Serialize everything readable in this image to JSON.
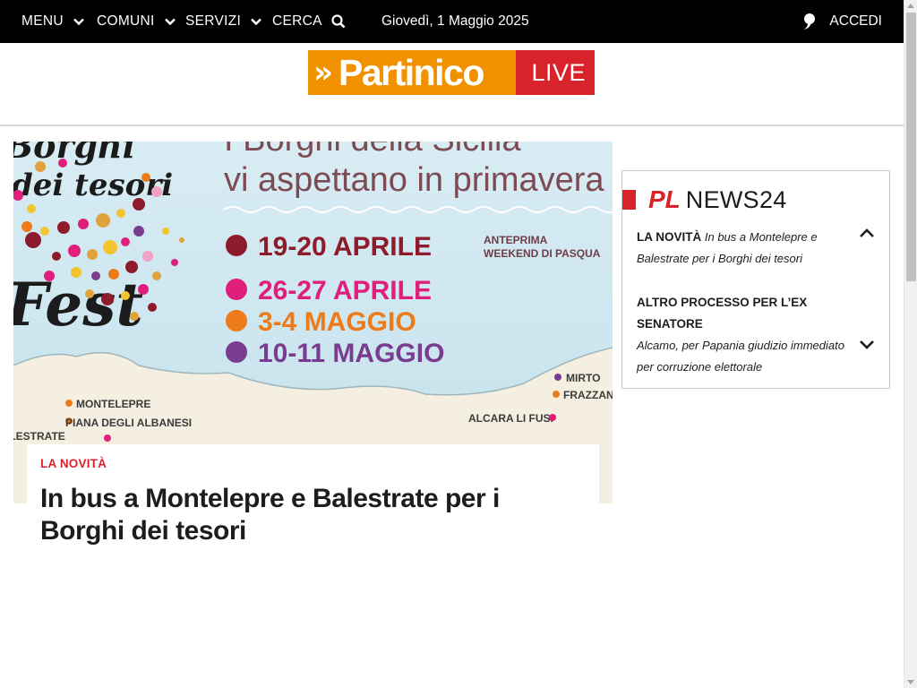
{
  "topbar": {
    "menu_label": "MENU",
    "comuni_label": "COMUNI",
    "servizi_label": "SERVIZI",
    "cerca_label": "CERCA",
    "date": "Giovedì, 1 Maggio 2025",
    "login_label": "ACCEDI"
  },
  "logo": {
    "arrows": "»",
    "name": "Partinico",
    "live": "LIVE",
    "orange": "#f29100",
    "red": "#d8232a"
  },
  "hero": {
    "image": {
      "line1": "I Borghi della Sicilia",
      "line2": "vi aspettano in primavera",
      "logo_line1": "Borghi",
      "logo_line2": "dei tesori",
      "logo_line3": "Fest",
      "dates": [
        {
          "label": "19-20 APRILE",
          "note1": "ANTEPRIMA",
          "note2": "WEEKEND DI PASQUA",
          "color": "#8d1b2b"
        },
        {
          "label": "26-27 APRILE",
          "color": "#e01f7c"
        },
        {
          "label": "3-4 MAGGIO",
          "color": "#ee7b1a"
        },
        {
          "label": "10-11 MAGGIO",
          "color": "#7a3c91"
        }
      ],
      "places": {
        "montelepre": "MONTELEPRE",
        "piana": "PIANA DEGLI ALBANESI",
        "balestrate": "BALESTRATE",
        "mirto": "MIRTO",
        "frazzano": "FRAZZANÒ",
        "alcara": "ALCARA LI FUSI"
      }
    },
    "kicker": "LA NOVITÀ",
    "title": "In bus a Montelepre e Balestrate per i Borghi dei tesori"
  },
  "news24": {
    "pl": "PL",
    "title": "NEWS24",
    "items": [
      {
        "kicker": "LA NOVITÀ",
        "text": "In bus a Montelepre e Balestrate per i Borghi dei tesori"
      },
      {
        "kicker": "ALTRO PROCESSO PER L’EX SENATORE",
        "text": "Alcamo, per Papania giudizio immediato per corruzione elettorale"
      }
    ]
  }
}
